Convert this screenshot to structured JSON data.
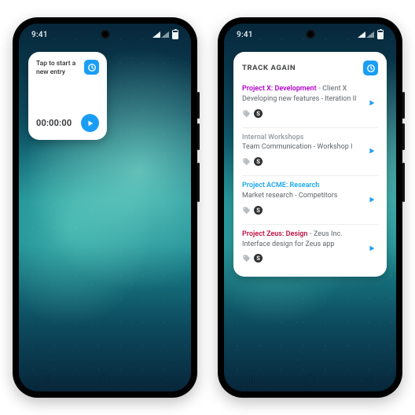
{
  "statusbar": {
    "time": "9:41"
  },
  "left_widget": {
    "prompt": "Tap to start a new entry",
    "timer": "00:00:00"
  },
  "right_widget": {
    "title": "TRACK AGAIN",
    "entries": [
      {
        "project": "Project X: Development",
        "project_color": "#b100c8",
        "client": "Client X",
        "description": "Developing new features - Iteration II",
        "has_tag": true,
        "has_billable": true
      },
      {
        "project": "Internal Workshops",
        "project_color": "#9aa0a6",
        "client": "",
        "description": "Team Communication - Workshop I",
        "has_tag": true,
        "has_billable": true
      },
      {
        "project": "Project ACME: Research",
        "project_color": "#1aa8ef",
        "client": "",
        "description": "Market research - Competitors",
        "has_tag": true,
        "has_billable": true
      },
      {
        "project": "Project Zeus: Design",
        "project_color": "#c01244",
        "client": "Zeus Inc.",
        "description": "Interface design for Zeus app",
        "has_tag": true,
        "has_billable": true
      }
    ]
  }
}
